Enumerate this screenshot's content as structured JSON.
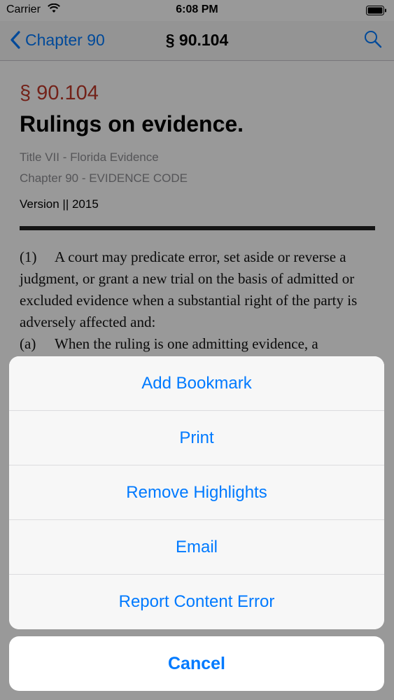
{
  "status_bar": {
    "carrier": "Carrier",
    "time": "6:08 PM"
  },
  "nav": {
    "back_label": "Chapter 90",
    "title": "§ 90.104"
  },
  "section": {
    "number": "§ 90.104",
    "title": "Rulings on evidence.",
    "title_line": "Title VII - Florida Evidence",
    "chapter_line": "Chapter 90 - EVIDENCE CODE",
    "version": "Version || 2015"
  },
  "body": {
    "p1_marker": "(1)",
    "p1_text": "A court may predicate error, set aside or reverse a judgment, or grant a new trial on the basis of admitted or excluded evidence when a substantial right of the party is adversely affected and:",
    "p2_marker": "(a)",
    "p2_text": "When the ruling is one admitting evidence, a"
  },
  "action_sheet": {
    "items": [
      {
        "label": "Add Bookmark"
      },
      {
        "label": "Print"
      },
      {
        "label": "Remove Highlights"
      },
      {
        "label": "Email"
      },
      {
        "label": "Report Content Error"
      }
    ],
    "cancel_label": "Cancel"
  },
  "colors": {
    "accent": "#007aff",
    "section_number": "#c0392b"
  },
  "icons": {
    "back": "chevron-left-icon",
    "search": "search-icon",
    "wifi": "wifi-icon",
    "battery": "battery-icon"
  }
}
